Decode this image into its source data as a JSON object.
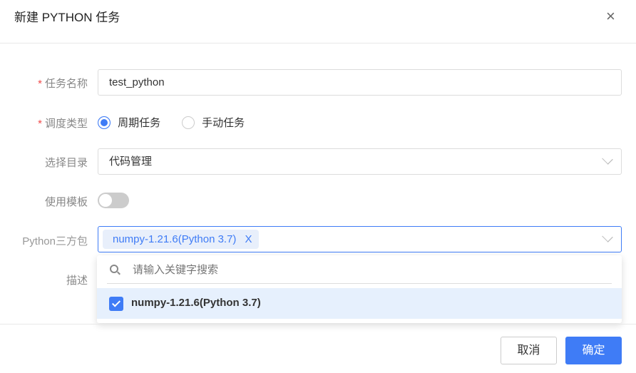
{
  "dialog": {
    "title": "新建 PYTHON 任务",
    "close_icon": "×"
  },
  "form": {
    "task_name": {
      "label": "任务名称",
      "required_mark": "*",
      "value": "test_python"
    },
    "schedule_type": {
      "label": "调度类型",
      "required_mark": "*",
      "options": [
        "周期任务",
        "手动任务"
      ],
      "selected": "周期任务"
    },
    "directory": {
      "label": "选择目录",
      "value": "代码管理"
    },
    "use_template": {
      "label": "使用模板",
      "enabled": false
    },
    "python_packages": {
      "label": "Python三方包",
      "tags": [
        "numpy-1.21.6(Python 3.7)"
      ],
      "tag_remove": "X"
    },
    "description": {
      "label": "描述"
    }
  },
  "dropdown": {
    "search_placeholder": "请输入关键字搜索",
    "options": [
      {
        "label": "numpy-1.21.6(Python 3.7)",
        "checked": true
      }
    ]
  },
  "footer": {
    "cancel": "取消",
    "confirm": "确定"
  },
  "colors": {
    "primary": "#3f7cf6",
    "required": "#f04b4b",
    "option_highlight": "#e6f0fd"
  }
}
